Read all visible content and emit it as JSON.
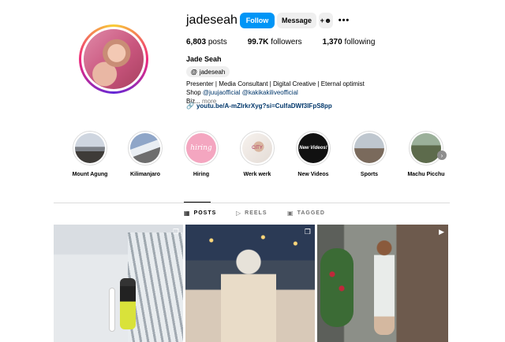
{
  "profile": {
    "username": "jadeseah",
    "verified_icon": "verified-badge-icon",
    "follow_label": "Follow",
    "message_label": "Message",
    "add_user_icon": "add-user-icon",
    "more_label": "•••",
    "stats": {
      "posts_count": "6,803",
      "posts_label": "posts",
      "followers_count": "99.7K",
      "followers_label": "followers",
      "following_count": "1,370",
      "following_label": "following"
    },
    "full_name": "Jade Seah",
    "threads_handle": "jadeseah",
    "bio": {
      "line1": "Presenter | Media Consultant | Digital Creative | Eternal optimist",
      "line2_prefix": "Shop ",
      "mention1": "@juujaofficial",
      "mention2": "@kakikakiliveofficial",
      "line3": "Biz...",
      "more": "more"
    },
    "link": "youtu.be/A-mZIrkrXyg?si=CulfaDWf3lFpS8pp"
  },
  "highlights": [
    {
      "label": "Mount Agung",
      "cover_text": ""
    },
    {
      "label": "Kilimanjaro",
      "cover_text": ""
    },
    {
      "label": "Hiring",
      "cover_text": "hiring"
    },
    {
      "label": "Werk werk",
      "cover_text": "CITY"
    },
    {
      "label": "New Videos",
      "cover_text": "New Videos!"
    },
    {
      "label": "Sports",
      "cover_text": ""
    },
    {
      "label": "Machu Picchu",
      "cover_text": ""
    }
  ],
  "tabs": {
    "posts": "POSTS",
    "reels": "REELS",
    "tagged": "TAGGED",
    "active": "POSTS"
  },
  "colors": {
    "follow_button": "#0095f6",
    "link": "#00376b",
    "secondary_button": "#efefef"
  }
}
